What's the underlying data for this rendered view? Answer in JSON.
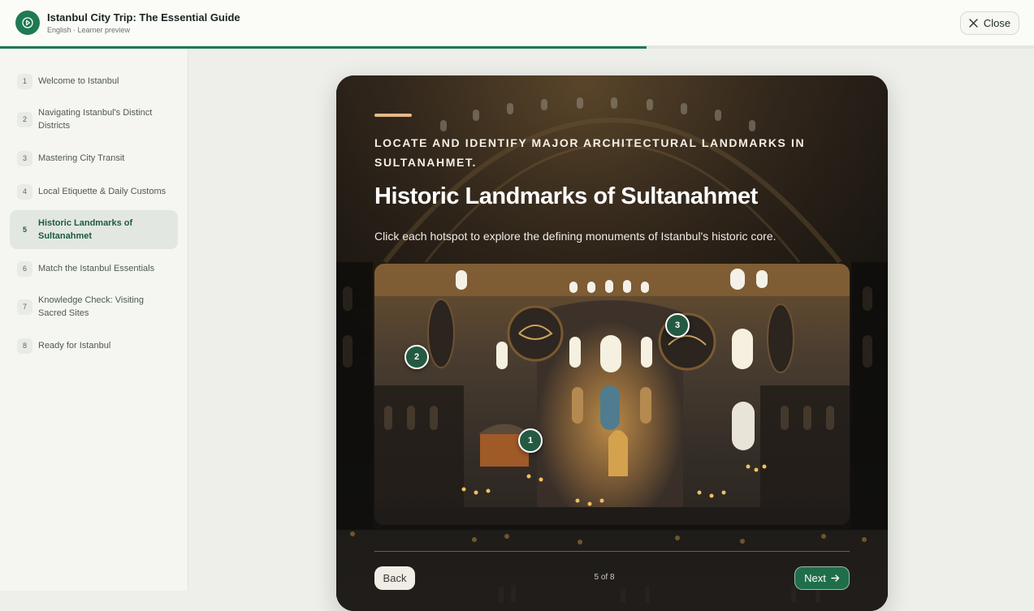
{
  "header": {
    "course_title": "Istanbul City Trip: The Essential Guide",
    "course_subtitle": "English · Learner preview",
    "close_label": "Close",
    "progress_fraction": 0.625
  },
  "sidebar": {
    "items": [
      {
        "num": "1",
        "label": "Welcome to Istanbul"
      },
      {
        "num": "2",
        "label": "Navigating Istanbul's Distinct Districts"
      },
      {
        "num": "3",
        "label": "Mastering City Transit"
      },
      {
        "num": "4",
        "label": "Local Etiquette & Daily Customs"
      },
      {
        "num": "5",
        "label": "Historic Landmarks of Sultanahmet",
        "active": true
      },
      {
        "num": "6",
        "label": "Match the Istanbul Essentials"
      },
      {
        "num": "7",
        "label": "Knowledge Check: Visiting Sacred Sites"
      },
      {
        "num": "8",
        "label": "Ready for Istanbul"
      }
    ]
  },
  "slide": {
    "objective": "Locate and identify major architectural landmarks in Sultanahmet.",
    "title": "Historic Landmarks of Sultanahmet",
    "instructions": "Click each hotspot to explore the defining monuments of Istanbul's historic core.",
    "hotspots": [
      {
        "label": "1"
      },
      {
        "label": "2"
      },
      {
        "label": "3"
      }
    ]
  },
  "footer": {
    "back_label": "Back",
    "counter": "5 of 8",
    "next_label": "Next"
  },
  "colors": {
    "brand": "#1f7a52",
    "active_nav": "#1e5a40",
    "hotspot": "#245a42",
    "accent_bar": "#e6b98a"
  }
}
